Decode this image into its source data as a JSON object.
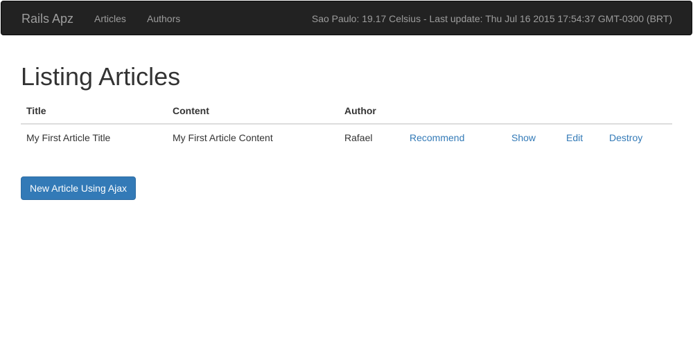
{
  "navbar": {
    "brand": "Rails Apz",
    "links": [
      "Articles",
      "Authors"
    ],
    "status": "Sao Paulo: 19.17 Celsius - Last update: Thu Jul 16 2015 17:54:37 GMT-0300 (BRT)"
  },
  "page": {
    "title": "Listing Articles",
    "new_button": "New Article Using Ajax"
  },
  "table": {
    "headers": [
      "Title",
      "Content",
      "Author"
    ],
    "rows": [
      {
        "title": "My First Article Title",
        "content": "My First Article Content",
        "author": "Rafael",
        "actions": [
          "Recommend",
          "Show",
          "Edit",
          "Destroy"
        ]
      }
    ]
  }
}
